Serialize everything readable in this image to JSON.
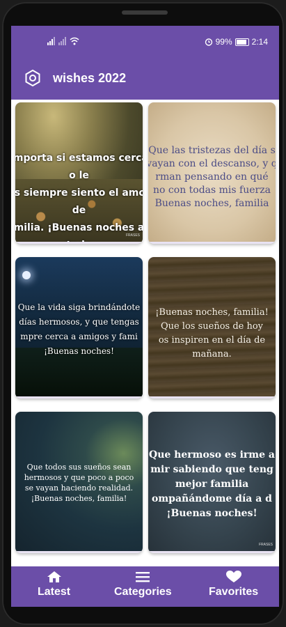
{
  "status": {
    "battery": "99%",
    "time": "2:14"
  },
  "appbar": {
    "title": "wishes 2022"
  },
  "cards": [
    {
      "quote": "importa si estamos cerca o le\nos siempre siento el amor de\nmilia. ¡Buenas noches a todo",
      "watermark": "FRASES"
    },
    {
      "quote": "Que las tristezas del día s\nvayan con el descanso, y q\nrman pensando en qué\nno con todas mis fuerza\nBuenas noches, familia",
      "watermark": ""
    },
    {
      "quote": "Que la vida siga brindándote\ndías hermosos, y que tengas\nmpre cerca a amigos y fami\n¡Buenas noches!",
      "watermark": ""
    },
    {
      "quote": "¡Buenas noches, familia!\nQue los sueños de hoy\nos inspiren en el día de mañana.",
      "watermark": ""
    },
    {
      "quote": "Que todos sus sueños sean\nhermosos y que poco a poco\nse vayan haciendo realidad.\n¡Buenas noches, familia!",
      "watermark": ""
    },
    {
      "quote": "Que hermoso es irme a\nmir sabiendo que teng\nmejor familia\nompañándome día a d\n¡Buenas noches!",
      "watermark": "FRASES"
    }
  ],
  "nav": {
    "latest": "Latest",
    "categories": "Categories",
    "favorites": "Favorites"
  }
}
